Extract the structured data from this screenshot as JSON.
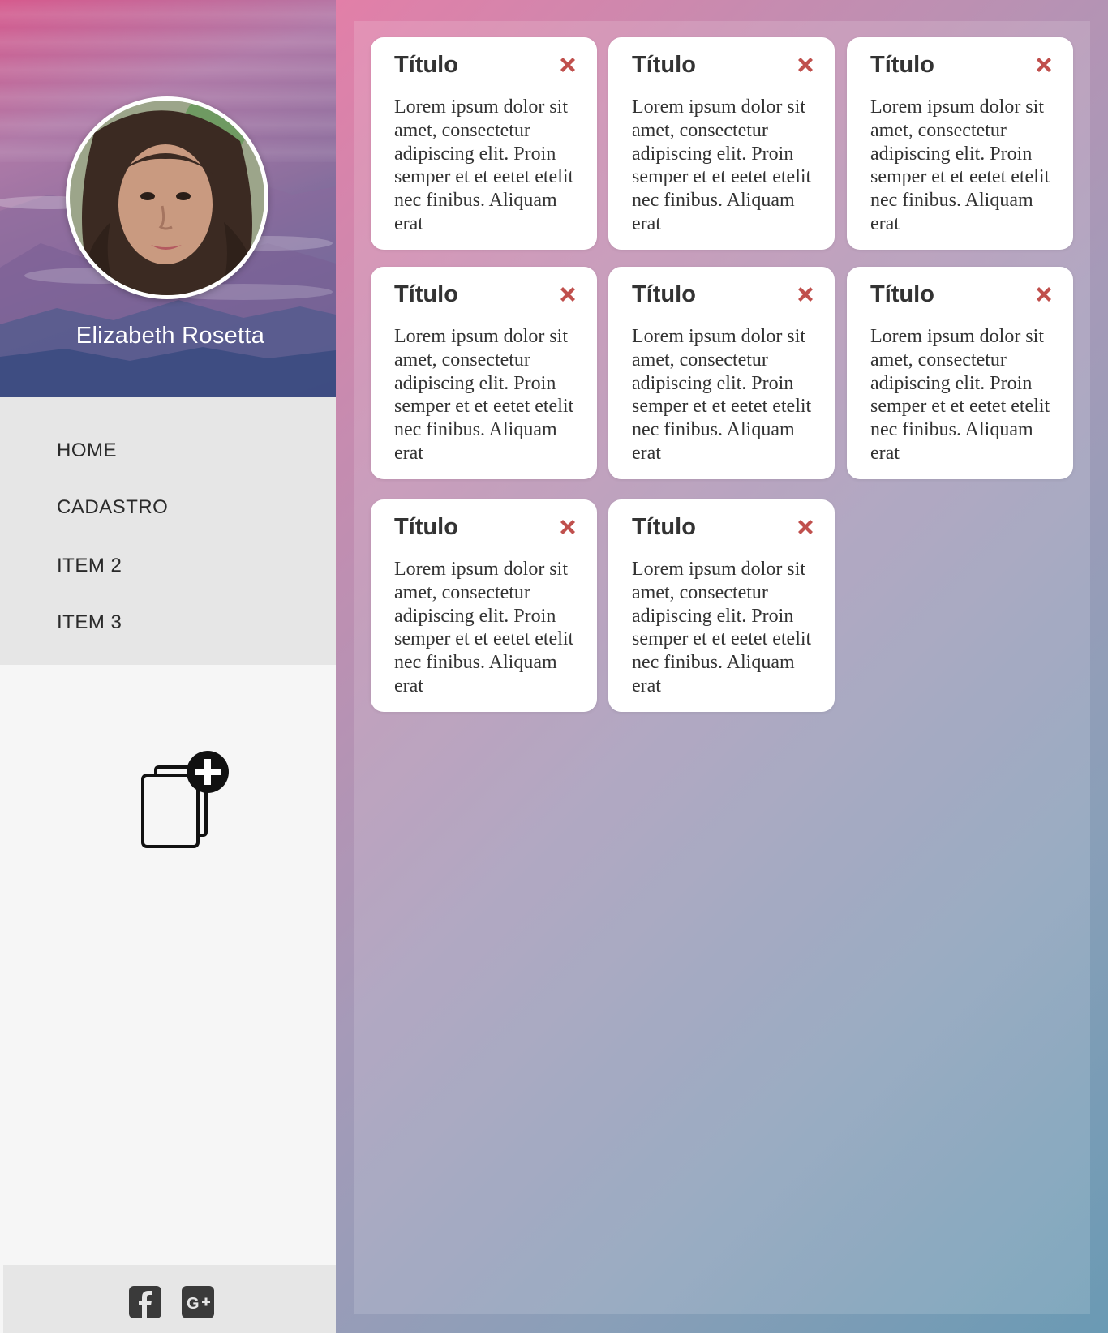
{
  "profile": {
    "name": "Elizabeth Rosetta"
  },
  "menu": {
    "items": [
      {
        "label": "HOME"
      },
      {
        "label": "CADASTRO"
      },
      {
        "label": "ITEM 2"
      },
      {
        "label": "ITEM 3"
      }
    ]
  },
  "add_button": {
    "icon": "add-document-icon"
  },
  "social": {
    "facebook": {
      "icon": "facebook-icon"
    },
    "google_plus": {
      "icon": "google-plus-icon"
    }
  },
  "cards": [
    {
      "title": "Título",
      "text": "Lorem ipsum dolor sit amet, consectetur adipiscing elit. Proin semper et et eetet etelit nec finibus. Aliquam erat"
    },
    {
      "title": "Título",
      "text": "Lorem ipsum dolor sit amet, consectetur adipiscing elit. Proin semper et et eetet etelit nec finibus. Aliquam erat"
    },
    {
      "title": "Título",
      "text": "Lorem ipsum dolor sit amet, consectetur adipiscing elit. Proin semper et et eetet etelit nec finibus. Aliquam erat"
    },
    {
      "title": "Título",
      "text": "Lorem ipsum dolor sit amet, consectetur adipiscing elit. Proin semper et et eetet etelit nec finibus. Aliquam erat"
    },
    {
      "title": "Título",
      "text": "Lorem ipsum dolor sit amet, consectetur adipiscing elit. Proin semper et et eetet etelit nec finibus. Aliquam erat"
    },
    {
      "title": "Título",
      "text": "Lorem ipsum dolor sit amet, consectetur adipiscing elit. Proin semper et et eetet etelit nec finibus. Aliquam erat"
    },
    {
      "title": "Título",
      "text": "Lorem ipsum dolor sit amet, consectetur adipiscing elit. Proin semper et et eetet etelit nec finibus. Aliquam erat"
    },
    {
      "title": "Título",
      "text": "Lorem ipsum dolor sit amet, consectetur adipiscing elit. Proin semper et et eetet etelit nec finibus. Aliquam erat"
    }
  ],
  "colors": {
    "close_icon": "#c0504d",
    "card_text": "#333333",
    "menu_background": "#e6e6e6",
    "sidebar_background": "#f6f6f6"
  }
}
